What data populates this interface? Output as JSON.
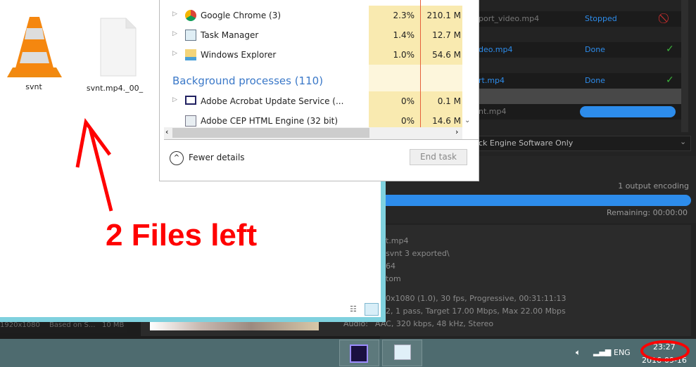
{
  "explorer": {
    "files": [
      {
        "name": "svnt",
        "icon": "vlc-cone-icon"
      },
      {
        "name": "svnt.mp4._00_",
        "icon": "blank-file-icon"
      }
    ]
  },
  "task_manager": {
    "apps": [
      {
        "name": "Google Chrome (3)",
        "cpu": "2.3%",
        "mem": "210.1 M",
        "icon": "chrome-icon"
      },
      {
        "name": "Task Manager",
        "cpu": "1.4%",
        "mem": "12.7 M",
        "icon": "task-manager-icon"
      },
      {
        "name": "Windows Explorer",
        "cpu": "1.0%",
        "mem": "54.6 M",
        "icon": "folder-icon"
      }
    ],
    "background_header": "Background processes (110)",
    "background": [
      {
        "name": "Adobe Acrobat Update Service (...",
        "cpu": "0%",
        "mem": "0.1 M"
      },
      {
        "name": "Adobe CEP HTML Engine (32 bit)",
        "cpu": "0%",
        "mem": "14.6 M"
      }
    ],
    "fewer_details": "Fewer details",
    "end_task": "End task"
  },
  "encoder": {
    "queue": [
      {
        "name": "port_video.mp4",
        "status": "Stopped",
        "icon": "stopped-icon"
      },
      {
        "name": "deo.mp4",
        "status": "Done",
        "icon": "check-icon"
      },
      {
        "name": "rt.mp4",
        "status": "Done",
        "icon": "check-icon"
      },
      {
        "name": "nt.mp4",
        "status": "",
        "progress": 1.0
      }
    ],
    "renderer": "ck Engine Software Only",
    "encoding_status": "1 output encoding",
    "overall_progress": 1.0,
    "remaining": "Remaining: 00:00:00",
    "info_lines": [
      "t.mp4",
      "svnt 3 exported\\",
      "64",
      "tom",
      "0x1080 (1.0), 30 fps, Progressive, 00:31:11:13",
      "2, 1 pass, Target 17.00 Mbps, Max 22.00 Mbps"
    ],
    "audio_label": "Audio:",
    "audio_value": "AAC, 320 kbps, 48 kHz, Stereo",
    "preset_row": [
      "1920x1080",
      "Based on S...",
      "10 MB"
    ]
  },
  "annotation": {
    "text": "2 Files left",
    "color": "#ff0000"
  },
  "taskbar": {
    "lang": "ENG",
    "time": "23:27",
    "date": "2016-09-16"
  }
}
